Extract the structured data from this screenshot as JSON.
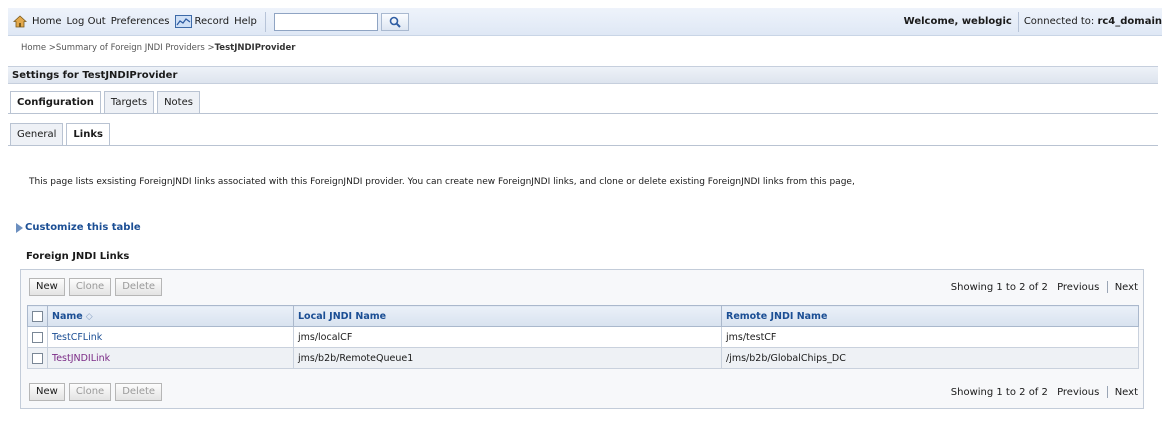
{
  "topbar": {
    "home": "Home",
    "logout": "Log Out",
    "preferences": "Preferences",
    "record": "Record",
    "help": "Help",
    "search_value": "",
    "welcome": "Welcome, weblogic",
    "connected_prefix": "Connected to:",
    "domain": "rc4_domain"
  },
  "breadcrumb": {
    "trail": "Home >Summary of Foreign JNDI Providers >",
    "current": "TestJNDIProvider"
  },
  "settings_title": "Settings for TestJNDIProvider",
  "tabs": [
    {
      "label": "Configuration",
      "active": true
    },
    {
      "label": "Targets",
      "active": false
    },
    {
      "label": "Notes",
      "active": false
    }
  ],
  "subtabs": [
    {
      "label": "General",
      "active": false
    },
    {
      "label": "Links",
      "active": true
    }
  ],
  "description": "This page lists exsisting ForeignJNDI links associated with this ForeignJNDI provider. You can create new ForeignJNDI links, and clone or delete existing ForeignJNDI links from this page,",
  "customize": "Customize this table",
  "section_title": "Foreign JNDI Links",
  "buttons": {
    "new": "New",
    "clone": "Clone",
    "delete": "Delete"
  },
  "paging": {
    "showing": "Showing 1 to 2 of 2",
    "previous": "Previous",
    "next": "Next"
  },
  "columns": {
    "name": "Name",
    "local": "Local JNDI Name",
    "remote": "Remote JNDI Name"
  },
  "rows": [
    {
      "name": "TestCFLink",
      "local": "jms/localCF",
      "remote": "jms/testCF"
    },
    {
      "name": "TestJNDILink",
      "local": "jms/b2b/RemoteQueue1",
      "remote": "/jms/b2b/GlobalChips_DC"
    }
  ],
  "icons": {
    "home": "home-icon",
    "record": "record-icon",
    "search": "search-icon",
    "sort": "sort-icon",
    "customize": "expand-triangle-icon"
  }
}
